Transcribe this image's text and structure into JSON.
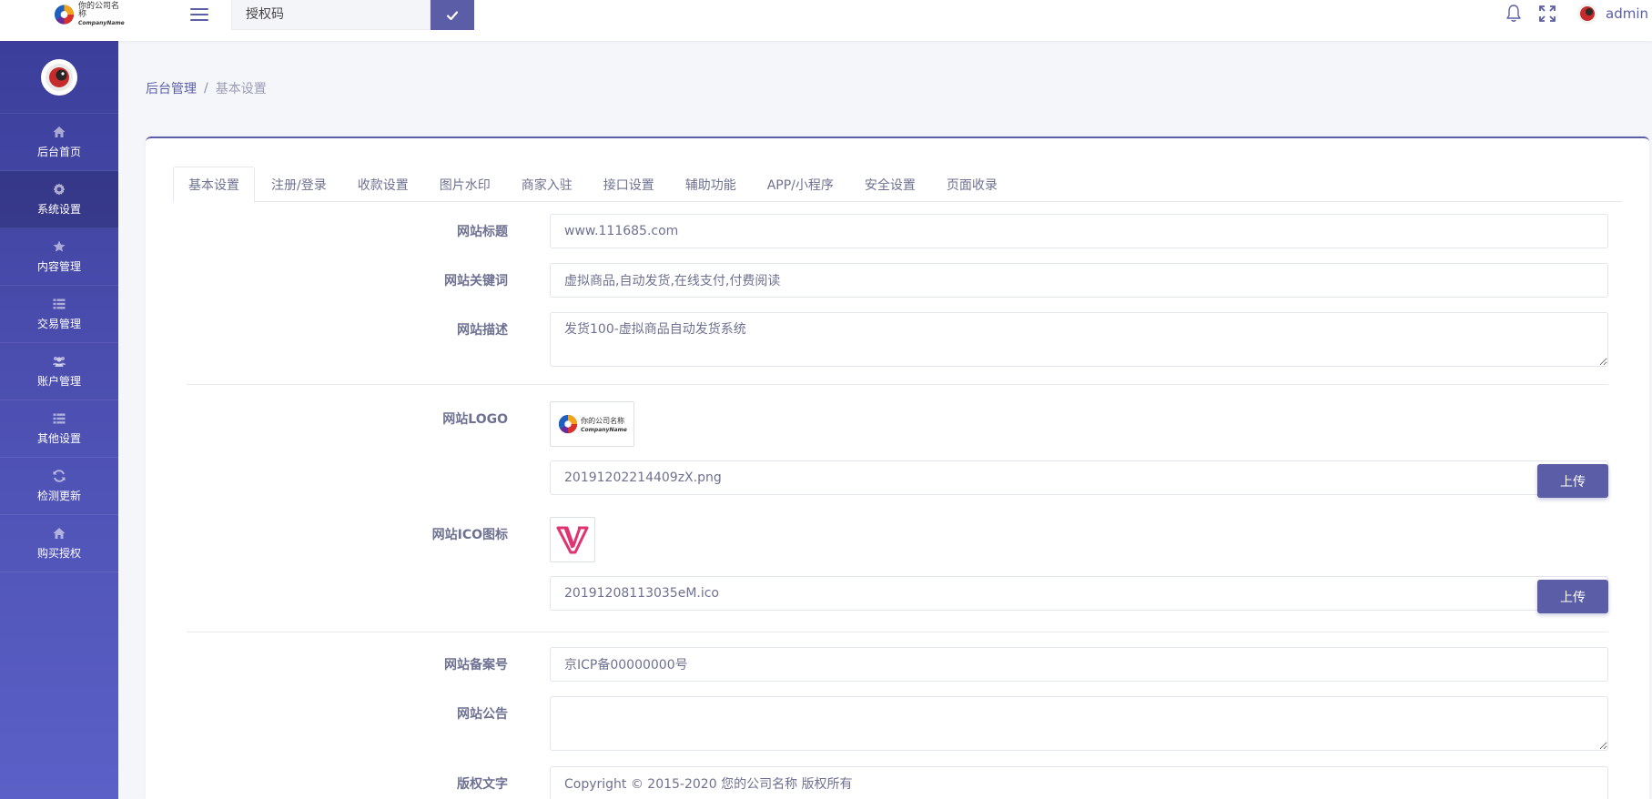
{
  "header": {
    "brand_cn": "你的公司名称",
    "brand_en": "CompanyName",
    "auth_placeholder": "授权码",
    "user_name": "admin"
  },
  "sidebar": {
    "items": [
      {
        "label": "后台首页",
        "icon": "home-icon"
      },
      {
        "label": "系统设置",
        "icon": "gear-icon"
      },
      {
        "label": "内容管理",
        "icon": "star-icon"
      },
      {
        "label": "交易管理",
        "icon": "list-icon"
      },
      {
        "label": "账户管理",
        "icon": "users-icon"
      },
      {
        "label": "其他设置",
        "icon": "list-icon"
      },
      {
        "label": "检测更新",
        "icon": "refresh-icon"
      },
      {
        "label": "购买授权",
        "icon": "home-icon"
      }
    ],
    "active_index": 1
  },
  "breadcrumb": {
    "root": "后台管理",
    "separator": "/",
    "current": "基本设置"
  },
  "tabs": [
    "基本设置",
    "注册/登录",
    "收款设置",
    "图片水印",
    "商家入驻",
    "接口设置",
    "辅助功能",
    "APP/小程序",
    "安全设置",
    "页面收录"
  ],
  "form": {
    "site_title_label": "网站标题",
    "site_title_value": "www.111685.com",
    "keywords_label": "网站关键词",
    "keywords_value": "虚拟商品,自动发货,在线支付,付费阅读",
    "description_label": "网站描述",
    "description_value": "发货100-虚拟商品自动发货系统",
    "logo_label": "网站LOGO",
    "logo_file": "20191202214409zX.png",
    "upload_label": "上传",
    "ico_label": "网站ICO图标",
    "ico_file": "20191208113035eM.ico",
    "icp_label": "网站备案号",
    "icp_value": "京ICP备00000000号",
    "notice_label": "网站公告",
    "notice_value": "",
    "copyright_label": "版权文字",
    "copyright_value": "Copyright © 2015-2020 您的公司名称 版权所有"
  },
  "colors": {
    "primary": "#5b5ea6",
    "sidebar_top": "#3c3e9b",
    "sidebar_bottom": "#5a60c7",
    "text": "#6e7191",
    "background": "#f5f6fa"
  }
}
